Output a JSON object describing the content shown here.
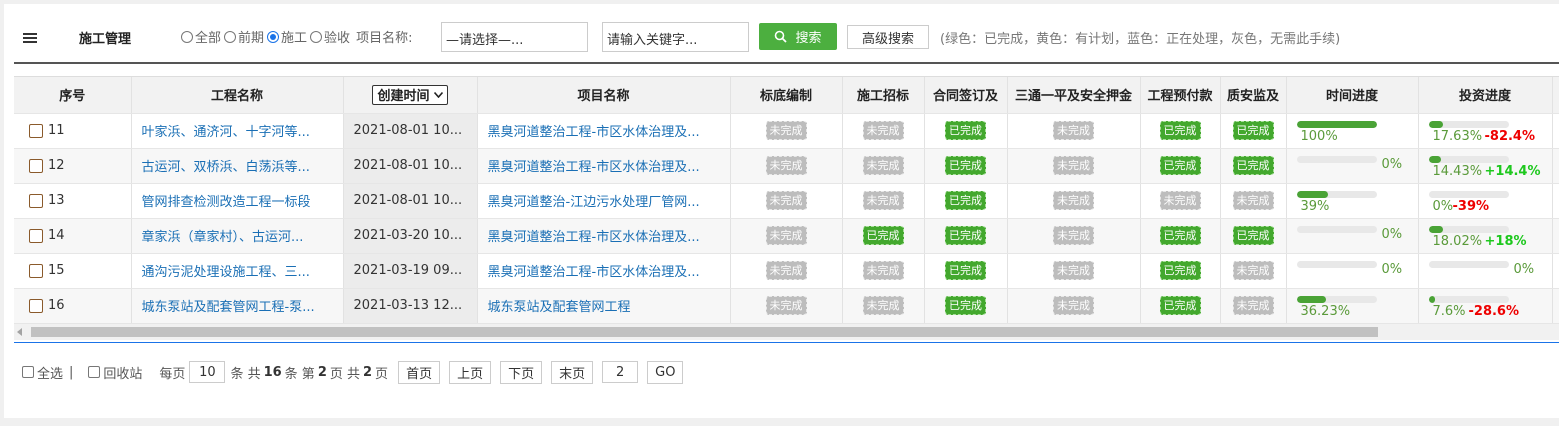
{
  "header": {
    "title": "施工管理",
    "radios": [
      {
        "label": "全部",
        "checked": false
      },
      {
        "label": "前期",
        "checked": false
      },
      {
        "label": "施工",
        "checked": true
      },
      {
        "label": "验收",
        "checked": false
      }
    ],
    "project_label": "项目名称:",
    "project_select": "—请选择—...",
    "keyword_value": "请输入关键字...",
    "search_label": "搜索",
    "advanced_label": "高级搜索",
    "legend_note": "(绿色：已完成，黄色：有计划，蓝色：正在处理，灰色，无需此手续)"
  },
  "colors": {
    "done": "#43a82e",
    "todo": "#bdbdbd",
    "link": "#1a6fb5",
    "negative": "#e00000",
    "positive": "#1ec81e"
  },
  "table": {
    "columns": [
      "序号",
      "工程名称",
      "创建时间",
      "项目名称",
      "标底编制",
      "施工招标",
      "合同签订及",
      "三通一平及安全押金",
      "工程预付款",
      "质安监及",
      "时间进度",
      "投资进度"
    ],
    "rows": [
      {
        "no": "11",
        "name": "叶家浜、通济河、十字河等...",
        "date": "2021-08-01 10...",
        "project": "黑臭河道整治工程-市区水体治理及...",
        "status": [
          "未完成",
          "未完成",
          "已完成",
          "未完成",
          "已完成",
          "已完成"
        ],
        "time_pct": 1.0,
        "time_text": "100%",
        "inv_pct": 0.1763,
        "inv_text": "17.63%",
        "inv_delta": "-82.4%"
      },
      {
        "no": "12",
        "name": "古运河、双桥浜、白荡浜等...",
        "date": "2021-08-01 10...",
        "project": "黑臭河道整治工程-市区水体治理及...",
        "status": [
          "未完成",
          "未完成",
          "已完成",
          "未完成",
          "已完成",
          "已完成"
        ],
        "time_pct": 0,
        "time_text": "0%",
        "inv_pct": 0.1443,
        "inv_text": "14.43%",
        "inv_delta": "+14.4%"
      },
      {
        "no": "13",
        "name": "管网排查检测改造工程一标段",
        "date": "2021-08-01 10...",
        "project": "黑臭河道整治-江边污水处理厂管网...",
        "status": [
          "未完成",
          "未完成",
          "已完成",
          "未完成",
          "未完成",
          "未完成"
        ],
        "time_pct": 0.39,
        "time_text": "39%",
        "inv_pct": 0,
        "inv_text": "0%",
        "inv_delta": "-39%"
      },
      {
        "no": "14",
        "name": "章家浜（章家村）、古运河...",
        "date": "2021-03-20 10...",
        "project": "黑臭河道整治工程-市区水体治理及...",
        "status": [
          "未完成",
          "已完成",
          "已完成",
          "未完成",
          "已完成",
          "已完成"
        ],
        "time_pct": 0,
        "time_text": "0%",
        "inv_pct": 0.1802,
        "inv_text": "18.02%",
        "inv_delta": "+18%"
      },
      {
        "no": "15",
        "name": "通沟污泥处理设施工程、三...",
        "date": "2021-03-19 09...",
        "project": "黑臭河道整治工程-市区水体治理及...",
        "status": [
          "未完成",
          "未完成",
          "已完成",
          "未完成",
          "已完成",
          "未完成"
        ],
        "time_pct": 0,
        "time_text": "0%",
        "inv_pct": 0,
        "inv_text": "0%",
        "inv_delta": ""
      },
      {
        "no": "16",
        "name": "城东泵站及配套管网工程-泵...",
        "date": "2021-03-13 12...",
        "project": "城东泵站及配套管网工程",
        "status": [
          "未完成",
          "未完成",
          "已完成",
          "未完成",
          "已完成",
          "未完成"
        ],
        "time_pct": 0.3623,
        "time_text": "36.23%",
        "inv_pct": 0.076,
        "inv_text": "7.6%",
        "inv_delta": "-28.6%"
      }
    ]
  },
  "pager": {
    "select_all": "全选",
    "separator": "|",
    "recycle": "回收站",
    "per_page_prefix": "每页",
    "per_page": "10",
    "per_page_suffix": "条 共",
    "total": "16",
    "total_suffix": "条 第",
    "current": "2",
    "current_suffix": "页 共",
    "pages": "2",
    "pages_suffix": "页",
    "first": "首页",
    "prev": "上页",
    "next": "下页",
    "last": "末页",
    "goto_value": "2",
    "go": "GO"
  }
}
